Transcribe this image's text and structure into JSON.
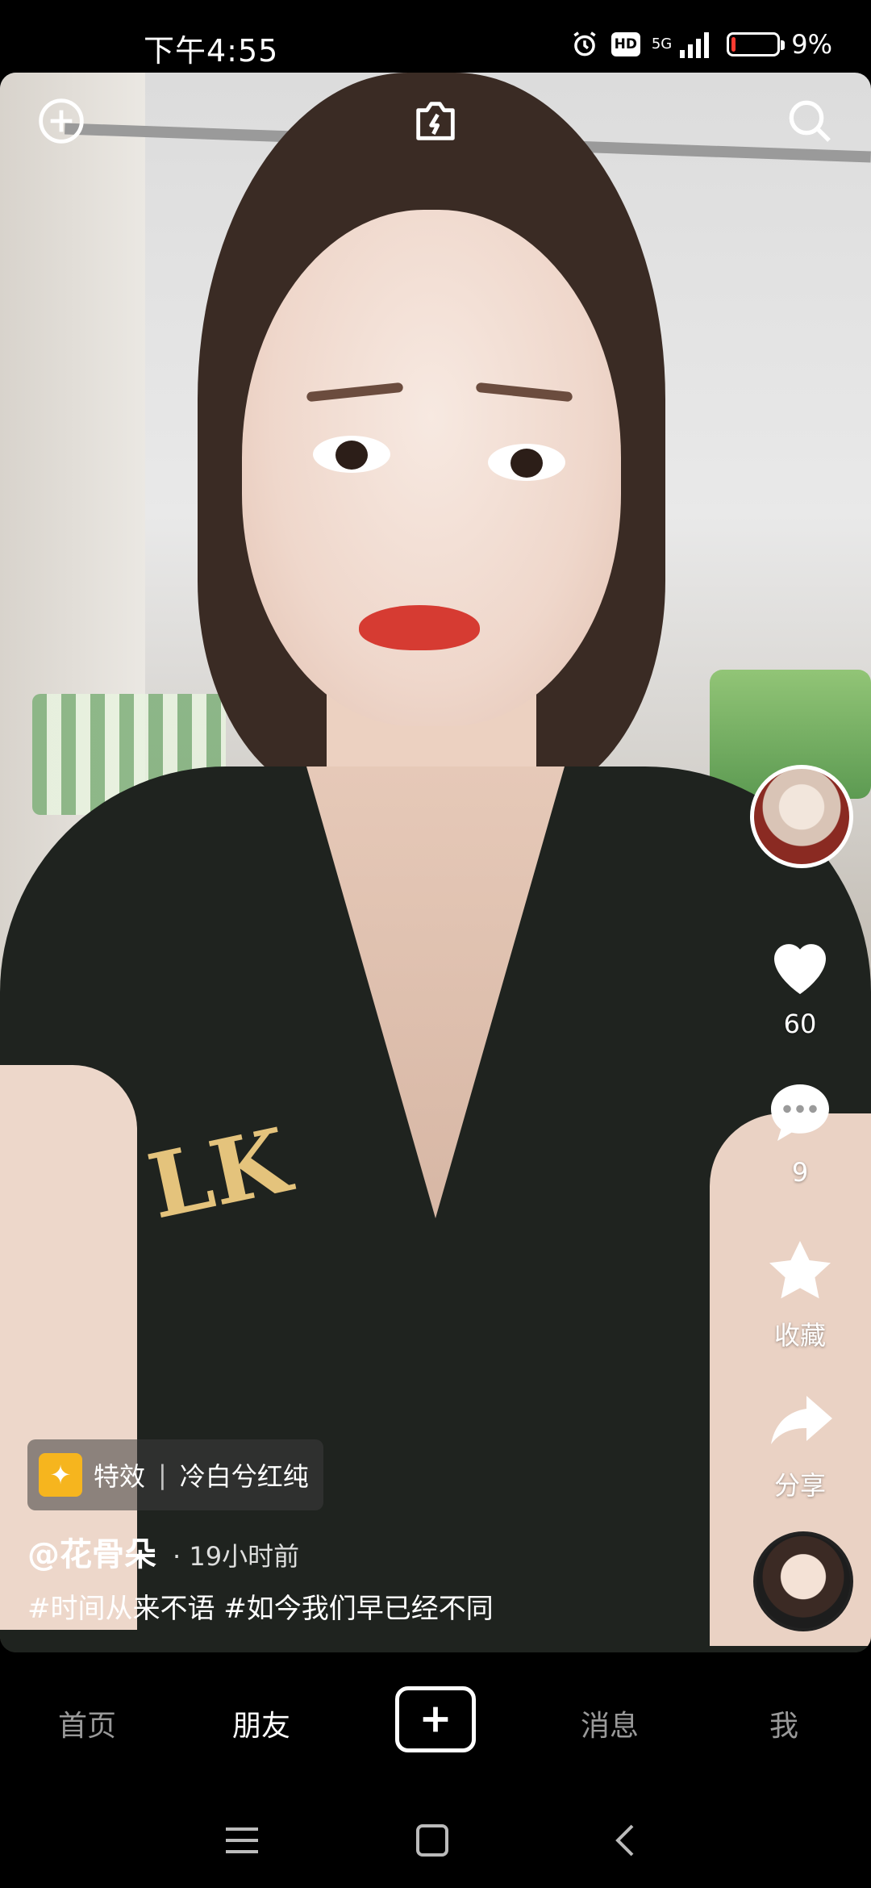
{
  "status_bar": {
    "time": "下午4:55",
    "hd_badge": "HD",
    "network": "5G",
    "battery_text": "9%",
    "battery_level": 0.09,
    "icons": [
      "alarm-icon",
      "hd-icon",
      "signal-icon",
      "battery-icon"
    ]
  },
  "top_bar": {
    "icons": [
      "add-circle-icon",
      "flash-camera-icon",
      "search-icon"
    ]
  },
  "actions": {
    "likes": "60",
    "comments": "9",
    "favorite_label": "收藏",
    "share_label": "分享"
  },
  "video_info": {
    "effect_label": "特效",
    "effect_name": "冷白兮红纯",
    "author": "@花骨朵",
    "post_time": "· 19小时前",
    "caption": "#时间从来不语 #如今我们早已经不同"
  },
  "bottom_nav": {
    "items": [
      "首页",
      "朋友",
      "消息",
      "我"
    ],
    "active": "朋友"
  },
  "colors": {
    "accent_battery": "#ff3b30",
    "effect_icon_bg": "#f6b51e",
    "nav_bg": "#000000"
  }
}
